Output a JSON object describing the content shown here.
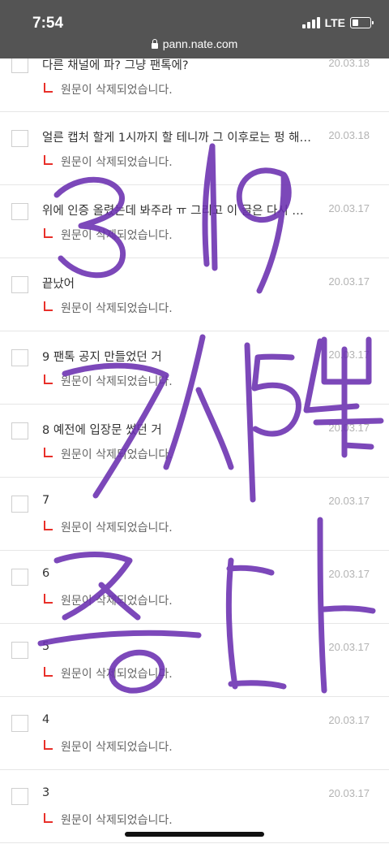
{
  "status_bar": {
    "time": "7:54",
    "network": "LTE",
    "url": "pann.nate.com"
  },
  "posts": [
    {
      "title": "다른 채널에 파? 그냥 팬톡에?",
      "date": "20.03.18",
      "reply": "원문이 삭제되었습니다."
    },
    {
      "title": "얼른 캡처 할게 1시까지 할 테니까 그 이후로는 펑 해…",
      "date": "20.03.18",
      "reply": "원문이 삭제되었습니다."
    },
    {
      "title": "위에 인증 올렸는데 봐주라 ㅠ 그리고 이 글은 다시 …",
      "date": "20.03.17",
      "reply": "원문이 삭제되었습니다."
    },
    {
      "title": "끝났어",
      "date": "20.03.17",
      "reply": "원문이 삭제되었습니다."
    },
    {
      "title": "9 팬톡 공지 만들었던 거",
      "date": "20.03.17",
      "reply": "원문이 삭제되었습니다."
    },
    {
      "title": "8 예전에 입장문 썼던 거",
      "date": "20.03.17",
      "reply": "원문이 삭제되었습니다."
    },
    {
      "title": "7",
      "date": "20.03.17",
      "reply": "원문이 삭제되었습니다."
    },
    {
      "title": "6",
      "date": "20.03.17",
      "reply": "원문이 삭제되었습니다."
    },
    {
      "title": "5",
      "date": "20.03.17",
      "reply": "원문이 삭제되었습니다."
    },
    {
      "title": "4",
      "date": "20.03.17",
      "reply": "원문이 삭제되었습니다."
    },
    {
      "title": "3",
      "date": "20.03.17",
      "reply": "원문이 삭제되었습니다."
    }
  ],
  "handwriting": {
    "lines": [
      "3/19",
      "7시54분",
      "종다"
    ],
    "color": "#6a2fb0"
  }
}
